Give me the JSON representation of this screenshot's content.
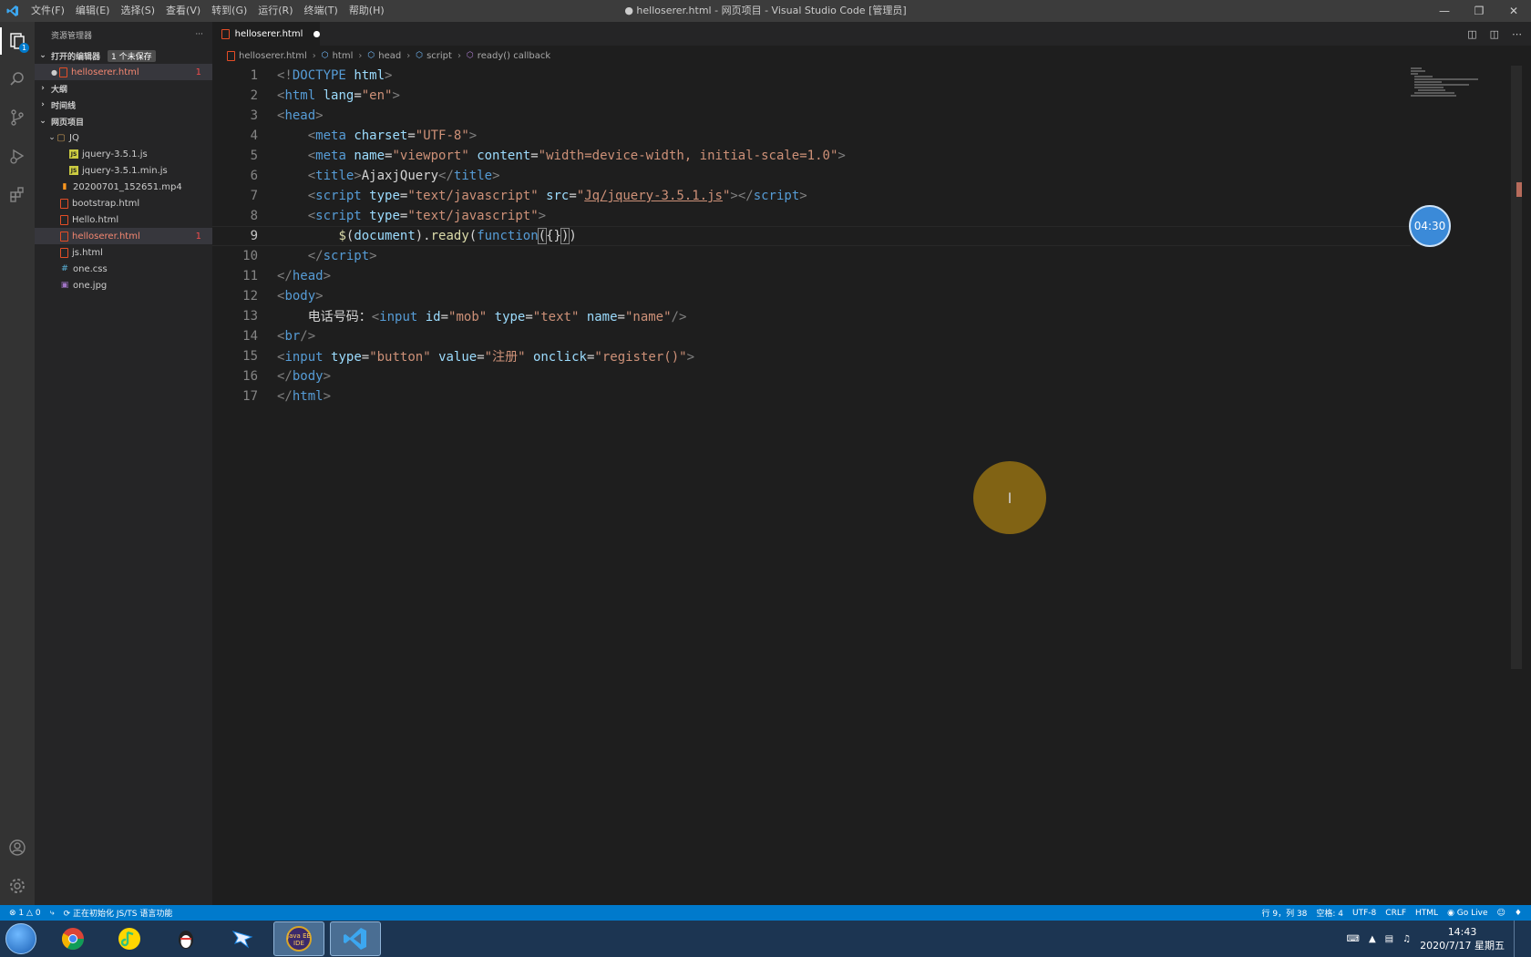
{
  "window": {
    "title": "● helloserer.html - 网页项目 - Visual Studio Code [管理员]",
    "menu": [
      "文件(F)",
      "编辑(E)",
      "选择(S)",
      "查看(V)",
      "转到(G)",
      "运行(R)",
      "终端(T)",
      "帮助(H)"
    ]
  },
  "activity": {
    "explorer_badge": "1"
  },
  "sidebar": {
    "title": "资源管理器",
    "more": "···",
    "open_editors": {
      "label": "打开的编辑器",
      "unsaved": "1 个未保存",
      "file": "helloserer.html",
      "count": "1"
    },
    "outline": "大纲",
    "timeline": "时间线",
    "project": {
      "label": "网页项目",
      "folder": "JQ",
      "folder_files": [
        "jquery-3.5.1.js",
        "jquery-3.5.1.min.js"
      ],
      "files": [
        {
          "name": "20200701_152651.mp4"
        },
        {
          "name": "bootstrap.html"
        },
        {
          "name": "Hello.html"
        },
        {
          "name": "helloserer.html",
          "count": "1"
        },
        {
          "name": "js.html"
        },
        {
          "name": "one.css"
        },
        {
          "name": "one.jpg"
        }
      ]
    }
  },
  "tab": {
    "label": "helloserer.html"
  },
  "breadcrumb": [
    "helloserer.html",
    "html",
    "head",
    "script",
    "ready() callback"
  ],
  "editor": {
    "line_numbers": [
      "1",
      "2",
      "3",
      "4",
      "5",
      "6",
      "7",
      "8",
      "9",
      "10",
      "11",
      "12",
      "13",
      "14",
      "15",
      "16",
      "17"
    ],
    "current_line": 9
  },
  "overlay": {
    "timer": "04:30",
    "cursor_glyph": "I"
  },
  "status": {
    "errors": "1",
    "warnings": "0",
    "task": "正在初始化 JS/TS 语言功能",
    "position": "行 9，列 38",
    "spaces": "空格: 4",
    "encoding": "UTF-8",
    "eol": "CRLF",
    "language": "HTML",
    "golive": "Go Live"
  },
  "taskbar": {
    "apps": [
      "windows-start",
      "chrome",
      "qq-music",
      "qq",
      "dingtalk",
      "java-ee-ide",
      "vscode"
    ],
    "java_label": "Java EE IDE",
    "time": "14:43",
    "date": "2020/7/17 星期五"
  },
  "colors": {
    "accent": "#007acc",
    "tag": "#569cd6",
    "attr": "#9cdcfe",
    "string": "#ce9178"
  }
}
